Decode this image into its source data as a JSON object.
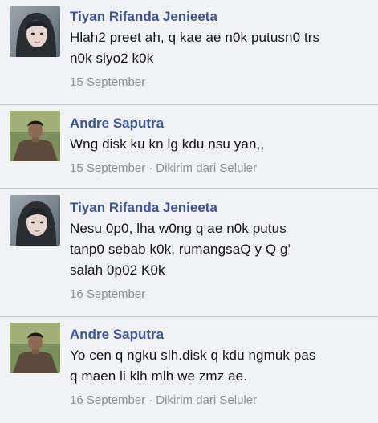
{
  "comments": [
    {
      "author": "Tiyan Rifanda Jenieeta",
      "text": "Hlah2 preet ah, q kae ae n0k putusn0 trs\nn0k siyo2 k0k",
      "date": "15 September",
      "via": ""
    },
    {
      "author": "Andre Saputra",
      "text": "Wng disk ku kn lg kdu nsu yan,,",
      "date": "15 September",
      "separator": "·",
      "via": "Dikirim dari Seluler"
    },
    {
      "author": "Tiyan Rifanda Jenieeta",
      "text": "Nesu 0p0, lha w0ng q ae n0k putus\ntanp0 sebab k0k, rumangsaQ y Q g'\nsalah 0p02 K0k",
      "date": "16 September",
      "via": ""
    },
    {
      "author": "Andre Saputra",
      "text": "Yo cen q ngku slh.disk q kdu ngmuk pas\nq maen li klh mlh we zmz ae.",
      "date": "16 September",
      "separator": "·",
      "via": "Dikirim dari Seluler"
    }
  ],
  "colors": {
    "author": "#3b5594",
    "meta": "#8d8f96",
    "background": "#f1f2f5"
  },
  "icons": [
    "avatar-female-photo",
    "avatar-male-photo"
  ]
}
